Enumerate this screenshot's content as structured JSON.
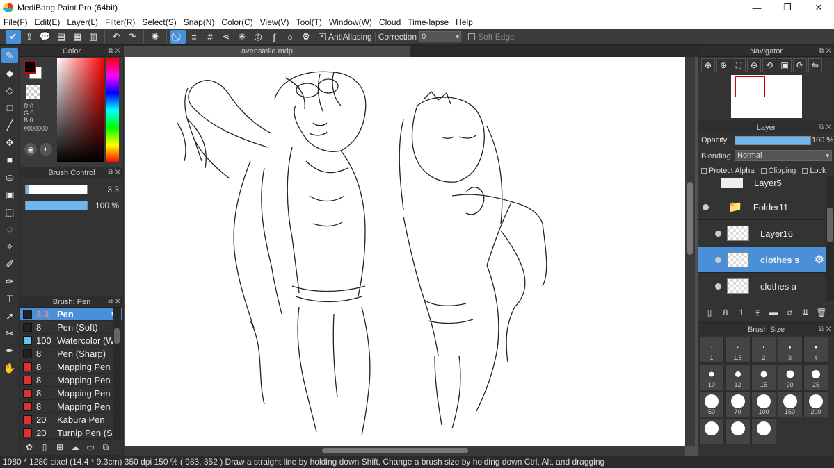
{
  "window": {
    "title": "MediBang Paint Pro (64bit)",
    "min": "—",
    "max": "❐",
    "close": "✕"
  },
  "menu": [
    "File(F)",
    "Edit(E)",
    "Layer(L)",
    "Filter(R)",
    "Select(S)",
    "Snap(N)",
    "Color(C)",
    "View(V)",
    "Tool(T)",
    "Window(W)",
    "Cloud",
    "Time-lapse",
    "Help"
  ],
  "toolbar": {
    "antialiasing_label": "AntiAliasing",
    "correction_label": "Correction",
    "correction_value": "0",
    "soft_edge_label": "Soft Edge"
  },
  "color_panel": {
    "title": "Color",
    "r": "R:0",
    "g": "G:0",
    "b": "B:0",
    "hex": "#000000",
    "foreground": "#000000",
    "background": "#ffffff"
  },
  "brush_control": {
    "title": "Brush Control",
    "size_value": "3.3",
    "opacity_value": "100 %",
    "opacity_fraction": 1.0
  },
  "brush_list": {
    "title": "Brush: Pen",
    "items": [
      {
        "size": "3.3",
        "name": "Pen",
        "color": "#222222"
      },
      {
        "size": "8",
        "name": "Pen (Soft)",
        "color": "#222222"
      },
      {
        "size": "100",
        "name": "Watercolor (W",
        "color": "#5bc8f0"
      },
      {
        "size": "8",
        "name": "Pen (Sharp)",
        "color": "#222222"
      },
      {
        "size": "8",
        "name": "Mapping Pen",
        "color": "#e03030"
      },
      {
        "size": "8",
        "name": "Mapping Pen (",
        "color": "#e03030"
      },
      {
        "size": "8",
        "name": "Mapping Pen (",
        "color": "#e03030"
      },
      {
        "size": "8",
        "name": "Mapping Pen (",
        "color": "#e03030"
      },
      {
        "size": "20",
        "name": "Kabura Pen",
        "color": "#e03030"
      },
      {
        "size": "20",
        "name": "Turnip Pen (Sc",
        "color": "#e03030"
      }
    ]
  },
  "document": {
    "tab": "avenstelle.mdp"
  },
  "navigator": {
    "title": "Navigator"
  },
  "layer_panel": {
    "title": "Layer",
    "opacity_label": "Opacity",
    "opacity_value": "100 %",
    "opacity_fraction": 1.0,
    "blending_label": "Blending",
    "blending_value": "Normal",
    "protect_alpha": "Protect Alpha",
    "clipping": "Clipping",
    "lock": "Lock",
    "layers": [
      {
        "name": "Layer5"
      },
      {
        "name": "Folder11"
      },
      {
        "name": "Layer16"
      },
      {
        "name": "clothes s"
      },
      {
        "name": "clothes a"
      }
    ]
  },
  "brush_size": {
    "title": "Brush Size",
    "sizes": [
      "1",
      "1.5",
      "2",
      "3",
      "4",
      "10",
      "12",
      "15",
      "20",
      "25",
      "50",
      "70",
      "100",
      "150",
      "200",
      "",
      "",
      ""
    ]
  },
  "status": "1980 * 1280 pixel   (14.4 * 9.3cm)   350 dpi   150 %   ( 983, 352 )   Draw a straight line by holding down Shift, Change a brush size by holding down Ctrl, Alt, and dragging"
}
